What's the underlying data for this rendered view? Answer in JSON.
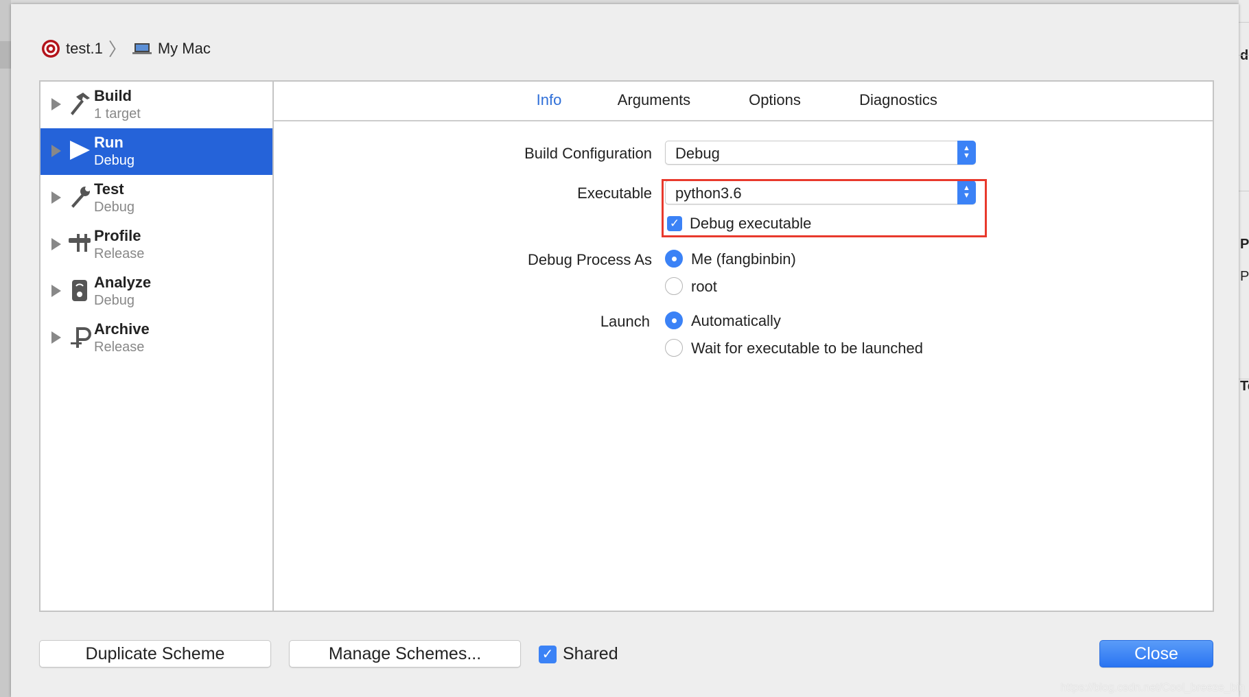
{
  "breadcrumb": {
    "scheme": "test.1",
    "destination": "My Mac"
  },
  "sidebar": {
    "items": [
      {
        "title": "Build",
        "subtitle": "1 target",
        "icon": "hammer-icon"
      },
      {
        "title": "Run",
        "subtitle": "Debug",
        "icon": "play-icon",
        "selected": true
      },
      {
        "title": "Test",
        "subtitle": "Debug",
        "icon": "wrench-icon"
      },
      {
        "title": "Profile",
        "subtitle": "Release",
        "icon": "caliper-icon"
      },
      {
        "title": "Analyze",
        "subtitle": "Debug",
        "icon": "analyze-icon"
      },
      {
        "title": "Archive",
        "subtitle": "Release",
        "icon": "clamp-icon"
      }
    ]
  },
  "tabs": [
    {
      "label": "Info",
      "active": true
    },
    {
      "label": "Arguments"
    },
    {
      "label": "Options"
    },
    {
      "label": "Diagnostics"
    }
  ],
  "info": {
    "build_configuration": {
      "label": "Build Configuration",
      "value": "Debug"
    },
    "executable": {
      "label": "Executable",
      "value": "python3.6",
      "debug_label": "Debug executable",
      "debug_checked": true
    },
    "debug_process_as": {
      "label": "Debug Process As",
      "options": [
        "Me (fangbinbin)",
        "root"
      ],
      "selected": 0
    },
    "launch": {
      "label": "Launch",
      "options": [
        "Automatically",
        "Wait for executable to be launched"
      ],
      "selected": 0
    }
  },
  "footer": {
    "duplicate": "Duplicate Scheme",
    "manage": "Manage Schemes...",
    "shared_label": "Shared",
    "shared_checked": true,
    "close": "Close"
  },
  "background": {
    "fragments": [
      "d",
      "Pr",
      "P",
      "Te"
    ]
  },
  "watermark": "https://blog.csdn.net/Cool_breeze_bin",
  "colors": {
    "accent": "#2563d9",
    "highlight": "#e8392c"
  }
}
